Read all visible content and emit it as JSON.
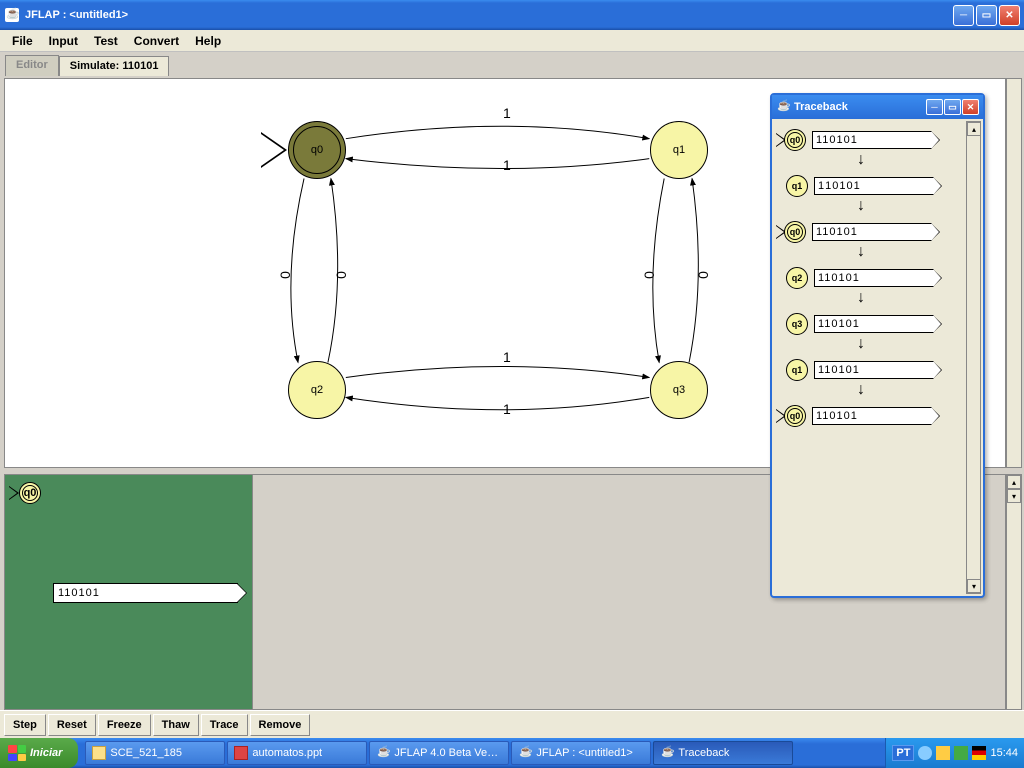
{
  "window": {
    "title": "JFLAP : <untitled1>"
  },
  "menu": {
    "file": "File",
    "input": "Input",
    "test": "Test",
    "convert": "Convert",
    "help": "Help"
  },
  "tabs": {
    "editor": "Editor",
    "simulate": "Simulate: 110101"
  },
  "states": {
    "q0": "q0",
    "q1": "q1",
    "q2": "q2",
    "q3": "q3"
  },
  "edges": {
    "one_a": "1",
    "one_b": "1",
    "one_c": "1",
    "one_d": "1",
    "zero_a": "0",
    "zero_b": "0",
    "zero_c": "0",
    "zero_d": "0"
  },
  "sim": {
    "current_state": "q0",
    "tape": "110101"
  },
  "buttons": {
    "step": "Step",
    "reset": "Reset",
    "freeze": "Freeze",
    "thaw": "Thaw",
    "trace": "Trace",
    "remove": "Remove"
  },
  "traceback": {
    "title": "Traceback",
    "rows": [
      {
        "state": "q0",
        "tape": "110101",
        "final": true,
        "start": true
      },
      {
        "state": "q1",
        "tape": "110101",
        "final": false,
        "start": false
      },
      {
        "state": "q0",
        "tape": "110101",
        "final": true,
        "start": true
      },
      {
        "state": "q2",
        "tape": "110101",
        "final": false,
        "start": false
      },
      {
        "state": "q3",
        "tape": "110101",
        "final": false,
        "start": false
      },
      {
        "state": "q1",
        "tape": "110101",
        "final": false,
        "start": false
      },
      {
        "state": "q0",
        "tape": "110101",
        "final": true,
        "start": true
      }
    ]
  },
  "taskbar": {
    "start": "Iniciar",
    "items": [
      "SCE_521_185",
      "automatos.ppt",
      "JFLAP 4.0 Beta Ve…",
      "JFLAP : <untitled1>",
      "Traceback"
    ],
    "lang": "PT",
    "clock": "15:44"
  }
}
